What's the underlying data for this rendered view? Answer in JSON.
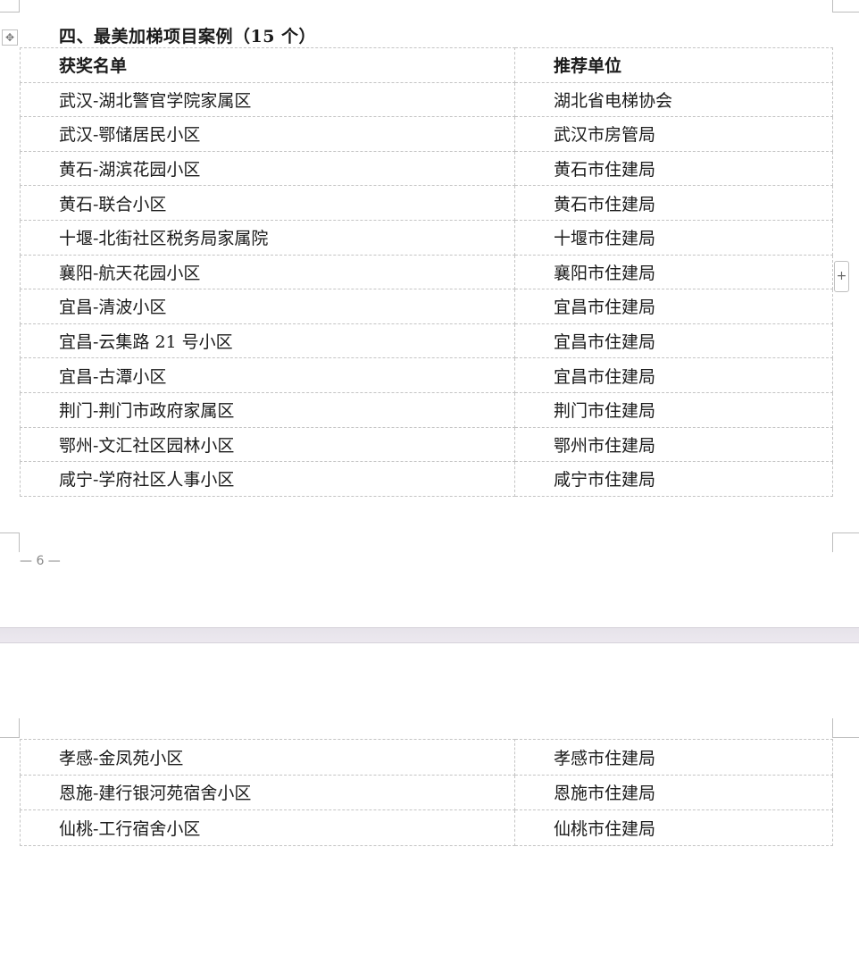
{
  "heading": "四、最美加梯项目案例（15 个）",
  "table": {
    "headers": [
      "获奖名单",
      "推荐单位"
    ],
    "rows_page1": [
      [
        "武汉-湖北警官学院家属区",
        "湖北省电梯协会"
      ],
      [
        "武汉-鄂储居民小区",
        "武汉市房管局"
      ],
      [
        "黄石-湖滨花园小区",
        "黄石市住建局"
      ],
      [
        "黄石-联合小区",
        "黄石市住建局"
      ],
      [
        "十堰-北街社区税务局家属院",
        "十堰市住建局"
      ],
      [
        "襄阳-航天花园小区",
        "襄阳市住建局"
      ],
      [
        "宜昌-清波小区",
        "宜昌市住建局"
      ],
      [
        "宜昌-云集路 21 号小区",
        "宜昌市住建局"
      ],
      [
        "宜昌-古潭小区",
        "宜昌市住建局"
      ],
      [
        "荆门-荆门市政府家属区",
        "荆门市住建局"
      ],
      [
        "鄂州-文汇社区园林小区",
        "鄂州市住建局"
      ],
      [
        "咸宁-学府社区人事小区",
        "咸宁市住建局"
      ]
    ],
    "rows_page2": [
      [
        "孝感-金凤苑小区",
        "孝感市住建局"
      ],
      [
        "恩施-建行银河苑宿舍小区",
        "恩施市住建局"
      ],
      [
        "仙桃-工行宿舍小区",
        "仙桃市住建局"
      ]
    ]
  },
  "page_number": "— 6 —",
  "icons": {
    "table_move": "move-icon",
    "table_add_row": "plus-icon"
  }
}
